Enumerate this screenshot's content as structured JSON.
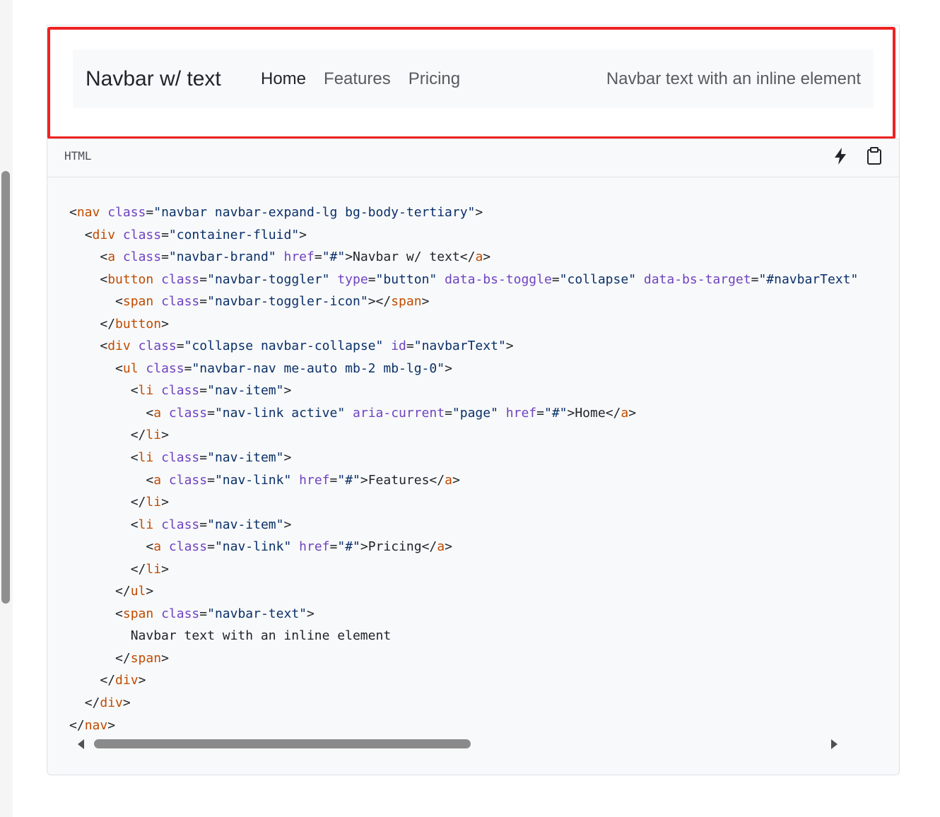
{
  "example": {
    "brand": "Navbar w/ text",
    "nav_links": [
      {
        "label": "Home",
        "active": true
      },
      {
        "label": "Features",
        "active": false
      },
      {
        "label": "Pricing",
        "active": false
      }
    ],
    "navbar_text": "Navbar text with an inline element"
  },
  "code_block": {
    "language": "HTML",
    "bolt_icon": "lightning-bolt-icon",
    "copy_icon": "clipboard-icon",
    "lines": [
      "<nav class=\"navbar navbar-expand-lg bg-body-tertiary\">",
      "  <div class=\"container-fluid\">",
      "    <a class=\"navbar-brand\" href=\"#\">Navbar w/ text</a>",
      "    <button class=\"navbar-toggler\" type=\"button\" data-bs-toggle=\"collapse\" data-bs-target=\"#navbarText\"",
      "      <span class=\"navbar-toggler-icon\"></span>",
      "    </button>",
      "    <div class=\"collapse navbar-collapse\" id=\"navbarText\">",
      "      <ul class=\"navbar-nav me-auto mb-2 mb-lg-0\">",
      "        <li class=\"nav-item\">",
      "          <a class=\"nav-link active\" aria-current=\"page\" href=\"#\">Home</a>",
      "        </li>",
      "        <li class=\"nav-item\">",
      "          <a class=\"nav-link\" href=\"#\">Features</a>",
      "        </li>",
      "        <li class=\"nav-item\">",
      "          <a class=\"nav-link\" href=\"#\">Pricing</a>",
      "        </li>",
      "      </ul>",
      "      <span class=\"navbar-text\">",
      "        Navbar text with an inline element",
      "      </span>",
      "    </div>",
      "  </div>",
      "</nav>"
    ]
  },
  "colors": {
    "highlight_border": "#ee2222",
    "navbar_bg": "#f8f9fa",
    "tag": "#c04c00",
    "attr": "#6f42c1",
    "value": "#0a3069"
  }
}
